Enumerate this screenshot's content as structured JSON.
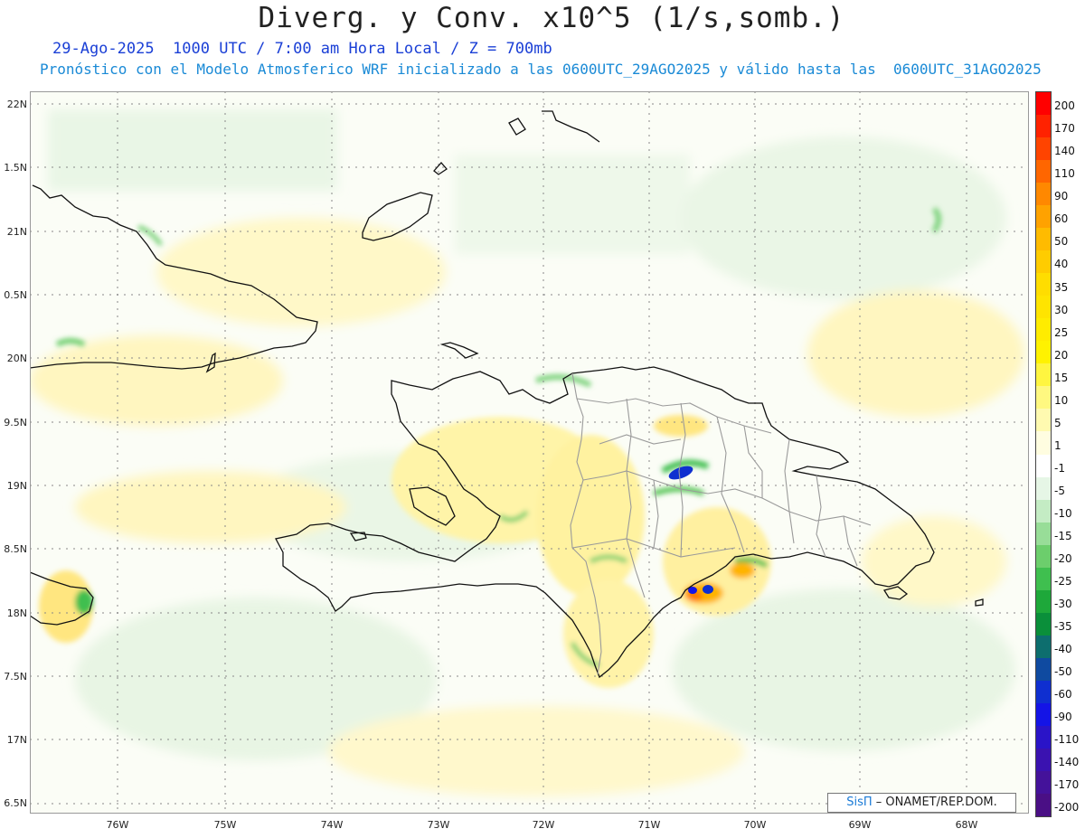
{
  "header": {
    "title": "Diverg. y Conv. x10^5 (1/s,somb.)",
    "subtitle_1": "29-Ago-2025  1000 UTC / 7:00 am Hora Local / Z = 700mb",
    "subtitle_2": "Pronóstico con el Modelo Atmosferico WRF inicializado a las 0600UTC_29AGO2025 y válido hasta las  0600UTC_31AGO2025"
  },
  "axes": {
    "lat_labels": [
      "22N",
      "1.5N",
      "21N",
      "0.5N",
      "20N",
      "9.5N",
      "19N",
      "8.5N",
      "18N",
      "7.5N",
      "17N",
      "6.5N"
    ],
    "lon_labels": [
      "76W",
      "75W",
      "74W",
      "73W",
      "72W",
      "71W",
      "70W",
      "69W",
      "68W"
    ]
  },
  "colorbar": {
    "labels": [
      "200",
      "170",
      "140",
      "110",
      "90",
      "60",
      "50",
      "40",
      "35",
      "30",
      "25",
      "20",
      "15",
      "10",
      "5",
      "1",
      "-1",
      "-5",
      "-10",
      "-15",
      "-20",
      "-25",
      "-30",
      "-35",
      "-40",
      "-50",
      "-60",
      "-90",
      "-110",
      "-140",
      "-170",
      "-200"
    ],
    "colors": [
      "#ff0000",
      "#ff2200",
      "#ff4400",
      "#ff6600",
      "#ff8800",
      "#ffa200",
      "#ffbb00",
      "#ffcc00",
      "#ffdd00",
      "#ffe400",
      "#ffec00",
      "#fff200",
      "#fff540",
      "#fff880",
      "#fffab0",
      "#fffde0",
      "#ffffff",
      "#e6f6e6",
      "#c4ecc4",
      "#98dd98",
      "#6cce6c",
      "#3fbf4f",
      "#1ea83a",
      "#0a8f3a",
      "#0d6e6e",
      "#0f4aa0",
      "#0f2fd0",
      "#1414e6",
      "#2a14c8",
      "#3a12b0",
      "#44129a",
      "#4a0f85"
    ]
  },
  "credit": {
    "brand": "SisΠ",
    "rest": "– ONAMET/REP.DOM."
  },
  "colors": {
    "divergence_light": "#fff6b0",
    "convergence_light": "#dff2dc",
    "convergence_strong": "#2fb44a"
  }
}
